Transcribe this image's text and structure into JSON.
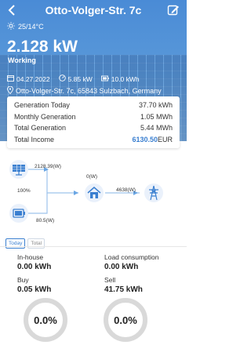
{
  "header": {
    "title": "Otto-Volger-Str. 7c",
    "weather": "25/14°C",
    "power": "2.128 kW",
    "status": "Working",
    "date": "04.27.2022",
    "capacity": "5.85 kW",
    "storage": "10.0 kWh",
    "address": "Otto-Volger-Str. 7c, 65843 Sulzbach, Germany"
  },
  "summary": {
    "rows": [
      {
        "label": "Generation Today",
        "value": "37.70 kWh"
      },
      {
        "label": "Monthly Generation",
        "value": "1.05 MWh"
      },
      {
        "label": "Total Generation",
        "value": "5.44 MWh"
      },
      {
        "label": "Total Income",
        "value": "6130.50",
        "unit": "EUR"
      }
    ]
  },
  "flow": {
    "solar_power": "2128.39(W)",
    "battery_soc": "100%",
    "battery_power": "80.5(W)",
    "home_power": "0(W)",
    "grid_power": "4638(W)"
  },
  "toggle": {
    "today": "Today",
    "total": "Total"
  },
  "stats": {
    "in_house_label": "In-house",
    "in_house_value": "0.00 kWh",
    "load_label": "Load consumption",
    "load_value": "0.00 kWh",
    "buy_label": "Buy",
    "buy_value": "0.05 kWh",
    "sell_label": "Sell",
    "sell_value": "41.75 kWh"
  },
  "rings": {
    "left": "0.0%",
    "right": "0.0%"
  },
  "colors": {
    "accent": "#3a7fd0",
    "hero": "#4a8bd6"
  }
}
